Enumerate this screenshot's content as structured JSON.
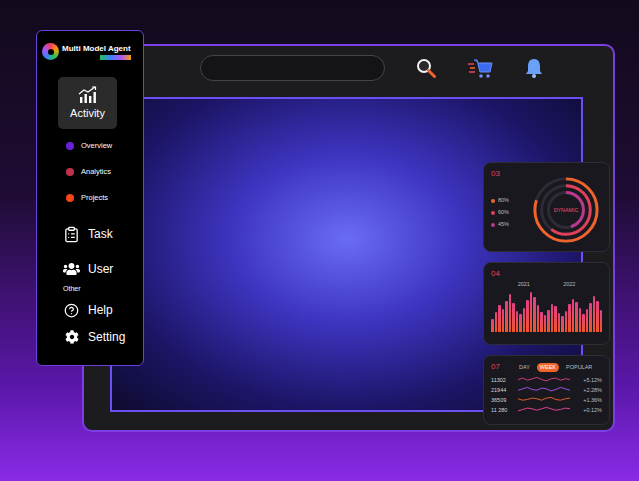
{
  "app": {
    "title": "Multi Model Agent"
  },
  "sidebar": {
    "items": [
      {
        "label": "Activity",
        "selected": true,
        "subitems": [
          {
            "label": "Overview",
            "color": "#6a1fd8"
          },
          {
            "label": "Analytics",
            "color": "#c2304d"
          },
          {
            "label": "Projects",
            "color": "#f2451c"
          }
        ]
      },
      {
        "label": "Task",
        "selected": false,
        "subitems": []
      },
      {
        "label": "User",
        "selected": false,
        "subitems": []
      }
    ],
    "group_label": "Other",
    "footer_items": [
      {
        "label": "Help",
        "selected": false
      },
      {
        "label": "Setting",
        "selected": false
      }
    ]
  },
  "cards": [
    {
      "kind": "donut",
      "number": "03",
      "center": "DYNAMIC",
      "legend": [
        {
          "label": "80%",
          "level": 0.8,
          "color": "#f0642c"
        },
        {
          "label": "60%",
          "level": 0.6,
          "color": "#e0405a"
        },
        {
          "label": "45%",
          "level": 0.45,
          "color": "#b83a8c"
        }
      ]
    },
    {
      "kind": "bars",
      "number": "04",
      "ticks": [
        "2021",
        "2022"
      ],
      "values": [
        30,
        45,
        60,
        52,
        70,
        85,
        66,
        48,
        40,
        55,
        72,
        90,
        78,
        60,
        45,
        38,
        50,
        64,
        58,
        42,
        35,
        48,
        62,
        75,
        68,
        55,
        40,
        52,
        66,
        80,
        70,
        50
      ]
    },
    {
      "kind": "lines",
      "number": "07",
      "tabs": [
        {
          "label": "DAY",
          "selected": false
        },
        {
          "label": "WEEK",
          "selected": true
        },
        {
          "label": "POPULAR",
          "selected": false
        }
      ],
      "rows": [
        {
          "value": "11302",
          "change": "+5.12%",
          "color": "#e0408a",
          "series": [
            5,
            7,
            4,
            6,
            8,
            5,
            3,
            6,
            7,
            4,
            6,
            5
          ]
        },
        {
          "value": "21944",
          "change": "+2.28%",
          "color": "#a855f7",
          "series": [
            4,
            6,
            8,
            5,
            4,
            7,
            6,
            3,
            5,
            8,
            6,
            4
          ]
        },
        {
          "value": "36509",
          "change": "+1.36%",
          "color": "#f0642c",
          "series": [
            6,
            4,
            5,
            7,
            6,
            4,
            7,
            8,
            5,
            4,
            6,
            7
          ]
        },
        {
          "value": "11 280",
          "change": "+0.12%",
          "color": "#ec4899",
          "series": [
            3,
            5,
            7,
            6,
            4,
            6,
            8,
            6,
            4,
            5,
            7,
            6
          ]
        }
      ]
    }
  ]
}
